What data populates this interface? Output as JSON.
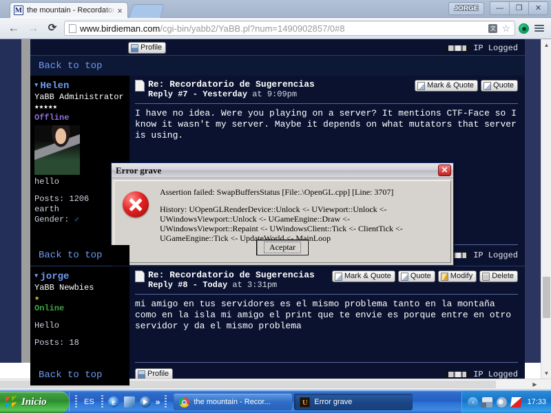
{
  "browser": {
    "tab": {
      "title": "the mountain - Recordatorio",
      "favicon_label": "M",
      "close_label": "×"
    },
    "window": {
      "user_label": "JORGE",
      "minimize_label": "—",
      "restore_label": "❐",
      "close_label": "✕"
    },
    "toolbar": {
      "back_label": "←",
      "forward_label": "→",
      "reload_label": "⟳",
      "url_domain": "www.birdieman.com",
      "url_path": "/cgi-bin/yabb2/YaBB.pl?num=1490902857/0#8",
      "translate_icon_label": "文",
      "star_label": "☆"
    }
  },
  "page": {
    "back_to_top_top": "Back to top",
    "back_to_top_mid": "Back to top",
    "back_to_top_bottom": "Back to top",
    "profile_label_top": "Profile",
    "profile_label_bottom": "Profile",
    "ip_logged_top": "IP Logged",
    "ip_logged_mid": "IP Logged",
    "ip_logged_bottom": "IP Logged",
    "posts": [
      {
        "username": "Helen",
        "rank": "YaBB Administrator",
        "stars": "★★★★★",
        "status": "Offline",
        "tagline": "hello",
        "posts_count": "Posts: 1206",
        "location": "earth",
        "gender_label": "Gender:",
        "gender_symbol": "♂",
        "subject": "Re: Recordatorio de Sugerencias",
        "reply_number": "Reply #7 - Yesterday",
        "reply_time": "at 9:09pm",
        "body": "I have no idea. Were you playing on a server? It mentions CTF-Face so I know it wasn't my server. Maybe it depends on what mutators that server is using.",
        "buttons": [
          "Mark & Quote",
          "Quote"
        ]
      },
      {
        "username": "jorge",
        "rank": "YaBB Newbies",
        "stars": "★",
        "status": "Online",
        "tagline": "Hello",
        "posts_count": "Posts: 18",
        "subject": "Re: Recordatorio de Sugerencias",
        "reply_number": "Reply #8 - Today",
        "reply_time": "at 3:31pm",
        "body": "mi amigo en tus servidores es el mismo problema tanto en la montaña como en la isla mi amigo el print que te envie es porque entre en otro servidor y da el mismo problema",
        "buttons": [
          "Mark & Quote",
          "Quote",
          "Modify",
          "Delete"
        ]
      }
    ]
  },
  "dialog": {
    "title": "Error grave",
    "close_label": "✕",
    "assertion": "Assertion failed: SwapBuffersStatus [File:.\\OpenGL.cpp] [Line: 3707]",
    "history": "History: UOpenGLRenderDevice::Unlock <- UViewport::Unlock <- UWindowsViewport::Unlock <- UGameEngine::Draw <- UWindowsViewport::Repaint <- UWindowsClient::Tick <- ClientTick <- UGameEngine::Tick <- UpdateWorld <- MainLoop",
    "ok_label": "Aceptar"
  },
  "taskbar": {
    "start_label": "Inicio",
    "language": "ES",
    "quick_more": "»",
    "tasks": [
      {
        "label": "the mountain - Recor...",
        "icon": "chrome-icon"
      },
      {
        "label": "Error grave",
        "icon": "unreal-tournament-icon"
      }
    ],
    "tray_hide_label": "‹",
    "clock": "17:33"
  }
}
